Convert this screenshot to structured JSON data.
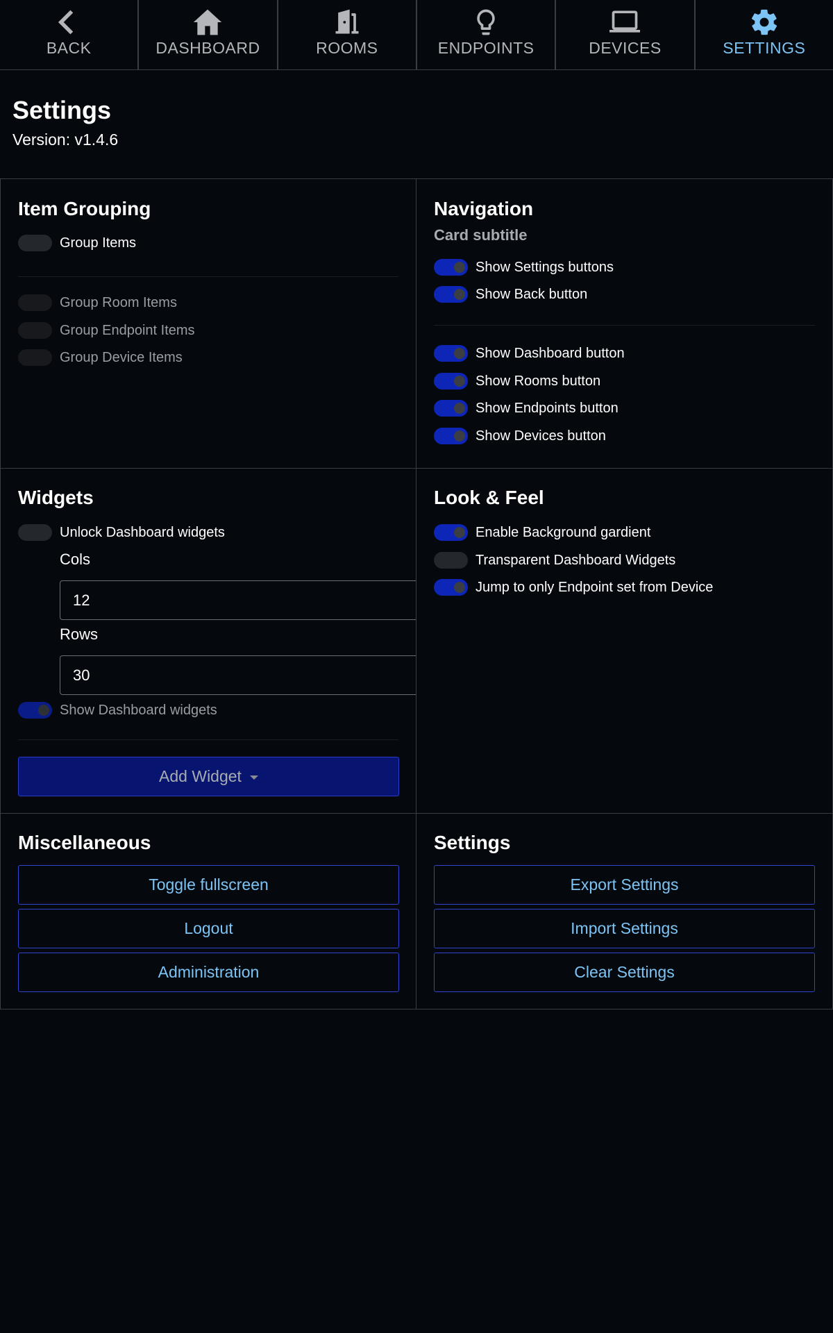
{
  "nav": {
    "items": [
      {
        "label": "BACK",
        "icon": "chevron-left-icon"
      },
      {
        "label": "DASHBOARD",
        "icon": "home-icon"
      },
      {
        "label": "ROOMS",
        "icon": "door-icon"
      },
      {
        "label": "ENDPOINTS",
        "icon": "lightbulb-icon"
      },
      {
        "label": "DEVICES",
        "icon": "monitor-icon"
      },
      {
        "label": "SETTINGS",
        "icon": "gear-icon",
        "active": true
      }
    ]
  },
  "header": {
    "title": "Settings",
    "version": "Version: v1.4.6"
  },
  "item_grouping": {
    "title": "Item Grouping",
    "group_items": {
      "label": "Group Items",
      "on": false
    },
    "group_room_items": {
      "label": "Group Room Items",
      "on": false,
      "disabled": true
    },
    "group_endpoint_items": {
      "label": "Group Endpoint Items",
      "on": false,
      "disabled": true
    },
    "group_device_items": {
      "label": "Group Device Items",
      "on": false,
      "disabled": true
    }
  },
  "navigation": {
    "title": "Navigation",
    "subtitle": "Card subtitle",
    "show_settings_buttons": {
      "label": "Show Settings buttons",
      "on": true
    },
    "show_back_button": {
      "label": "Show Back button",
      "on": true
    },
    "show_dashboard_button": {
      "label": "Show Dashboard button",
      "on": true
    },
    "show_rooms_button": {
      "label": "Show Rooms button",
      "on": true
    },
    "show_endpoints_button": {
      "label": "Show Endpoints button",
      "on": true
    },
    "show_devices_button": {
      "label": "Show Devices button",
      "on": true
    }
  },
  "widgets": {
    "title": "Widgets",
    "unlock": {
      "label": "Unlock Dashboard widgets",
      "on": false
    },
    "cols_label": "Cols",
    "cols_value": "12",
    "rows_label": "Rows",
    "rows_value": "30",
    "show_widgets": {
      "label": "Show Dashboard widgets",
      "on": true,
      "disabled": true
    },
    "add_widget_label": "Add Widget"
  },
  "look_feel": {
    "title": "Look & Feel",
    "background_gradient": {
      "label": "Enable Background gardient",
      "on": true
    },
    "transparent_widgets": {
      "label": "Transparent Dashboard Widgets",
      "on": false
    },
    "jump_endpoint": {
      "label": "Jump to only Endpoint set from Device",
      "on": true
    }
  },
  "misc": {
    "title": "Miscellaneous",
    "toggle_fullscreen": "Toggle fullscreen",
    "logout": "Logout",
    "administration": "Administration"
  },
  "settings_card": {
    "title": "Settings",
    "export": "Export Settings",
    "import": "Import Settings",
    "clear": "Clear Settings"
  },
  "colors": {
    "background": "#05080c",
    "accent": "#7cc4f5",
    "toggle_on": "#0d26b8",
    "border": "#3a3d42"
  }
}
